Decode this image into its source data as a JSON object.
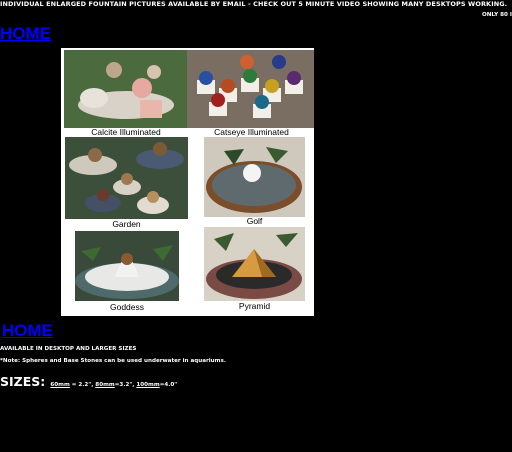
{
  "banner": {
    "text": "INDIVIDUAL ENLARGED FOUNTAIN PICTURES AVAILABLE BY EMAIL - CHECK OUT 5 MINUTE VIDEO SHOWING MANY DESKTOPS WORKING.",
    "right_note": "ONLY 80 I"
  },
  "nav": {
    "home_top": "HOME",
    "home_bottom": "HOME"
  },
  "gallery": {
    "captions": [
      "Calcite Illuminated",
      "Catseye Illuminated",
      "Garden",
      "Golf",
      "Goddess",
      "Pyramid"
    ]
  },
  "info": {
    "availability": "AVAILABLE IN DESKTOP AND LARGER   SIZES",
    "note": "*Note: Spheres and Base Stones can be used underwater in aquariums.",
    "sizes_label": "SIZES:",
    "size_1": "60mm",
    "size_1_eq": " = 2.2\",  ",
    "size_2": "80mm",
    "size_2_eq": "=3.2\",  ",
    "size_3": "100mm",
    "size_3_eq": "=4.0\""
  },
  "colors": {
    "background": "#000000",
    "link": "#0000ff",
    "text": "#ffffff"
  }
}
